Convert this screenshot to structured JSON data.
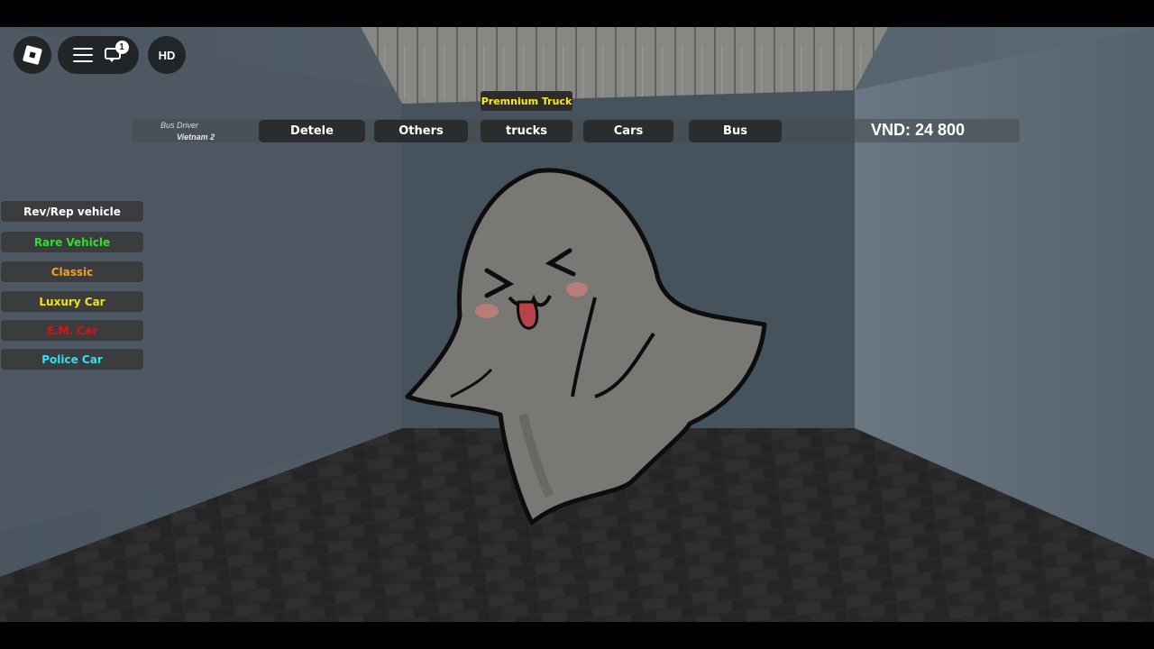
{
  "hud": {
    "chat_badge_count": "1",
    "hd_label": "HD"
  },
  "shop_bar": {
    "job_title": "Bus Driver",
    "game_name": "Vietnam 2",
    "premium_label": "Premnium Truck",
    "categories": [
      {
        "label": "Detele"
      },
      {
        "label": "Others"
      },
      {
        "label": "trucks"
      },
      {
        "label": "Cars"
      },
      {
        "label": "Bus"
      }
    ],
    "money": "VND: 24 800"
  },
  "side_menu": {
    "items": [
      {
        "label": "Rev/Rep vehicle",
        "color": "#ffffff"
      },
      {
        "label": "Rare Vehicle",
        "color": "#2ee02e"
      },
      {
        "label": "Classic",
        "color": "#f0a020"
      },
      {
        "label": "Luxury Car",
        "color": "#f2e21a"
      },
      {
        "label": "E.M. Car",
        "color": "#e01010"
      },
      {
        "label": "Police Car",
        "color": "#2fe0f0"
      }
    ]
  },
  "colors": {
    "ghost_body": "#7a7875",
    "ghost_outline": "#0d0d0d",
    "floor": "#2f2f2f",
    "wall": "#5b6670"
  }
}
